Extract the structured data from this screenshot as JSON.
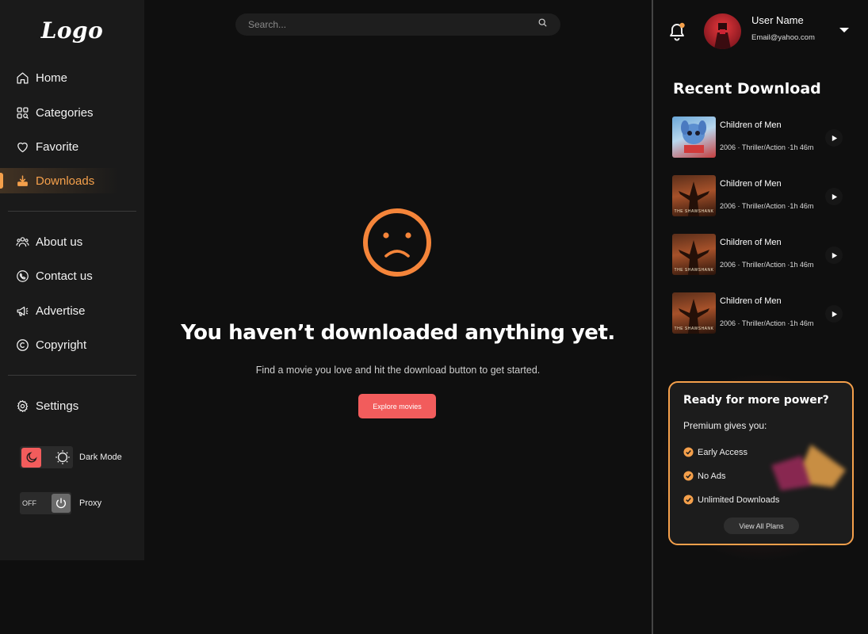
{
  "sidebar": {
    "logo": "Logo",
    "nav_primary": [
      {
        "label": "Home",
        "icon": "home-icon"
      },
      {
        "label": "Categories",
        "icon": "categories-icon"
      },
      {
        "label": "Favorite",
        "icon": "heart-icon"
      },
      {
        "label": "Downloads",
        "icon": "download-icon",
        "active": true
      }
    ],
    "nav_secondary": [
      {
        "label": "About us",
        "icon": "people-icon"
      },
      {
        "label": "Contact us",
        "icon": "phone-icon"
      },
      {
        "label": "Advertise",
        "icon": "megaphone-icon"
      },
      {
        "label": "Copyright",
        "icon": "copyright-icon"
      }
    ],
    "settings_label": "Settings",
    "dark_mode_label": "Dark Mode",
    "proxy_state": "OFF",
    "proxy_label": "Proxy"
  },
  "search": {
    "placeholder": "Search..."
  },
  "empty_state": {
    "title": "You haven’t downloaded anything yet.",
    "subtitle": "Find a movie you love and hit the download button to get started.",
    "button": "Explore movies"
  },
  "user": {
    "name": "User Name",
    "email": "Email@yahoo.com"
  },
  "recent": {
    "title": "Recent Download",
    "items": [
      {
        "title": "Children of Men",
        "meta": "2006 · Thriller/Action ·1h 46m",
        "poster": "blue"
      },
      {
        "title": "Children of Men",
        "meta": "2006 · Thriller/Action ·1h 46m",
        "poster": "brown",
        "poster_text": "THE SHAWSHANK"
      },
      {
        "title": "Children of Men",
        "meta": "2006 · Thriller/Action ·1h 46m",
        "poster": "brown",
        "poster_text": "THE SHAWSHANK"
      },
      {
        "title": "Children of Men",
        "meta": "2006 · Thriller/Action ·1h 46m",
        "poster": "brown",
        "poster_text": "THE SHAWSHANK"
      }
    ]
  },
  "promo": {
    "title": "Ready for more power?",
    "subtitle": "Premium gives you:",
    "perks": [
      "Early Access",
      "No Ads",
      "Unlimited Downloads"
    ],
    "button": "View All Plans"
  },
  "colors": {
    "accent": "#f5a04b",
    "primary_button": "#f25c5c",
    "background": "#0f0f0f",
    "sidebar": "#1a1a1a"
  }
}
